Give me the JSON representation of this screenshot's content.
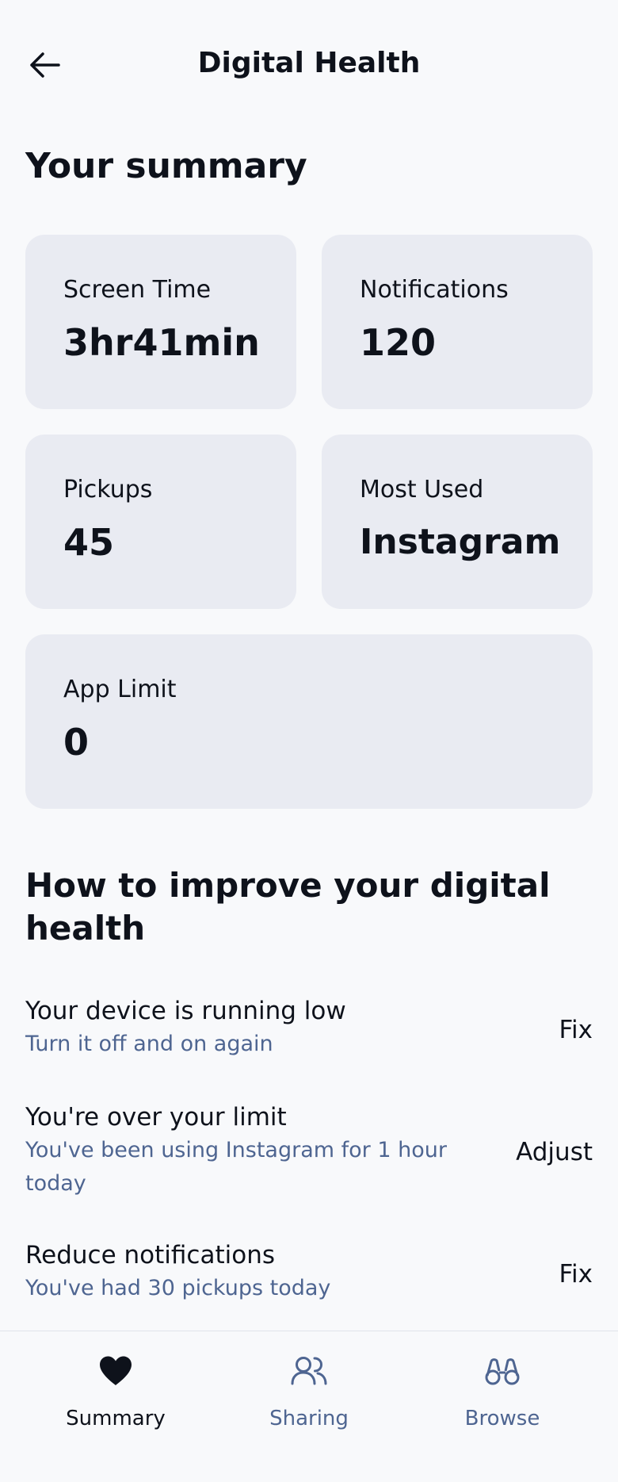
{
  "header": {
    "title": "Digital Health"
  },
  "summary": {
    "title": "Your summary",
    "cards": [
      {
        "label": "Screen Time",
        "value": "3hr41min"
      },
      {
        "label": "Notifications",
        "value": "120"
      },
      {
        "label": "Pickups",
        "value": "45"
      },
      {
        "label": "Most Used",
        "value": "Instagram"
      },
      {
        "label": "App Limit",
        "value": "0"
      }
    ]
  },
  "improve": {
    "title": "How to improve your digital health",
    "tips": [
      {
        "title": "Your device is running low",
        "subtitle": "Turn it off and on again",
        "action": "Fix"
      },
      {
        "title": "You're over your limit",
        "subtitle": "You've been using Instagram for 1 hour today",
        "action": "Adjust"
      },
      {
        "title": "Reduce notifications",
        "subtitle": "You've had 30 pickups today",
        "action": "Fix"
      }
    ]
  },
  "tabbar": {
    "tabs": [
      {
        "label": "Summary",
        "icon": "heart-icon",
        "active": true
      },
      {
        "label": "Sharing",
        "icon": "people-icon",
        "active": false
      },
      {
        "label": "Browse",
        "icon": "binoculars-icon",
        "active": false
      }
    ]
  },
  "colors": {
    "background": "#f8f9fb",
    "card": "#e9ebf2",
    "text_primary": "#0e121b",
    "text_secondary": "#4e6591"
  }
}
